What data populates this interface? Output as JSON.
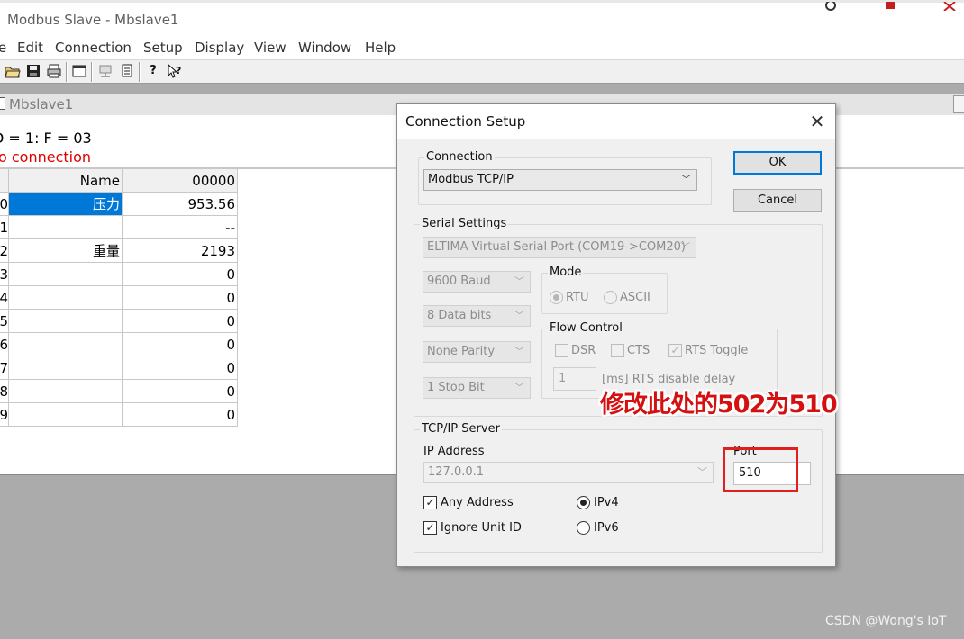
{
  "app": {
    "title": "Modbus Slave - Mbslave1"
  },
  "menu": [
    "e",
    "Edit",
    "Connection",
    "Setup",
    "Display",
    "View",
    "Window",
    "Help"
  ],
  "toolbar": {
    "icons": [
      "open-folder-icon",
      "save-icon",
      "print-icon",
      "window-icon",
      "connect-icon",
      "print-preview-icon",
      "help-icon",
      "context-help-icon"
    ]
  },
  "child": {
    "title": "Mbslave1",
    "line1": "D = 1: F = 03",
    "line2": "o connection"
  },
  "table": {
    "header": {
      "index": "",
      "name": "Name",
      "value": "00000"
    },
    "rows": [
      {
        "index": "0",
        "name": "压力",
        "value": "953.56",
        "selected": true
      },
      {
        "index": "1",
        "name": "",
        "value": "--"
      },
      {
        "index": "2",
        "name": "重量",
        "value": "2193"
      },
      {
        "index": "3",
        "name": "",
        "value": "0"
      },
      {
        "index": "4",
        "name": "",
        "value": "0"
      },
      {
        "index": "5",
        "name": "",
        "value": "0"
      },
      {
        "index": "6",
        "name": "",
        "value": "0"
      },
      {
        "index": "7",
        "name": "",
        "value": "0"
      },
      {
        "index": "8",
        "name": "",
        "value": "0"
      },
      {
        "index": "9",
        "name": "",
        "value": "0"
      }
    ]
  },
  "dialog": {
    "title": "Connection Setup",
    "close": "✕",
    "connection": {
      "label": "Connection",
      "value": "Modbus TCP/IP"
    },
    "ok": "OK",
    "cancel": "Cancel",
    "serial": {
      "label": "Serial Settings",
      "port": "ELTIMA Virtual Serial Port (COM19->COM20)",
      "baud": "9600 Baud",
      "databits": "8 Data bits",
      "parity": "None Parity",
      "stopbit": "1 Stop Bit",
      "mode": {
        "label": "Mode",
        "rtu": "RTU",
        "ascii": "ASCII",
        "selected": "RTU"
      },
      "flow": {
        "label": "Flow Control",
        "dsr": "DSR",
        "cts": "CTS",
        "rts_toggle": "RTS Toggle",
        "rts_toggle_checked": true,
        "delay_value": "1",
        "delay_label": "[ms] RTS disable delay"
      }
    },
    "tcp": {
      "label": "TCP/IP Server",
      "ip_label": "IP Address",
      "ip_value": "127.0.0.1",
      "port_label": "Port",
      "port_value": "510",
      "any_address": "Any Address",
      "any_address_checked": true,
      "ignore_unit": "Ignore Unit ID",
      "ignore_unit_checked": true,
      "ipv4": "IPv4",
      "ipv6": "IPv6",
      "ip_version_selected": "IPv4"
    }
  },
  "annotation": {
    "text": "修改此处的502为510",
    "color": "#e02020"
  },
  "watermark": "CSDN @Wong's IoT"
}
